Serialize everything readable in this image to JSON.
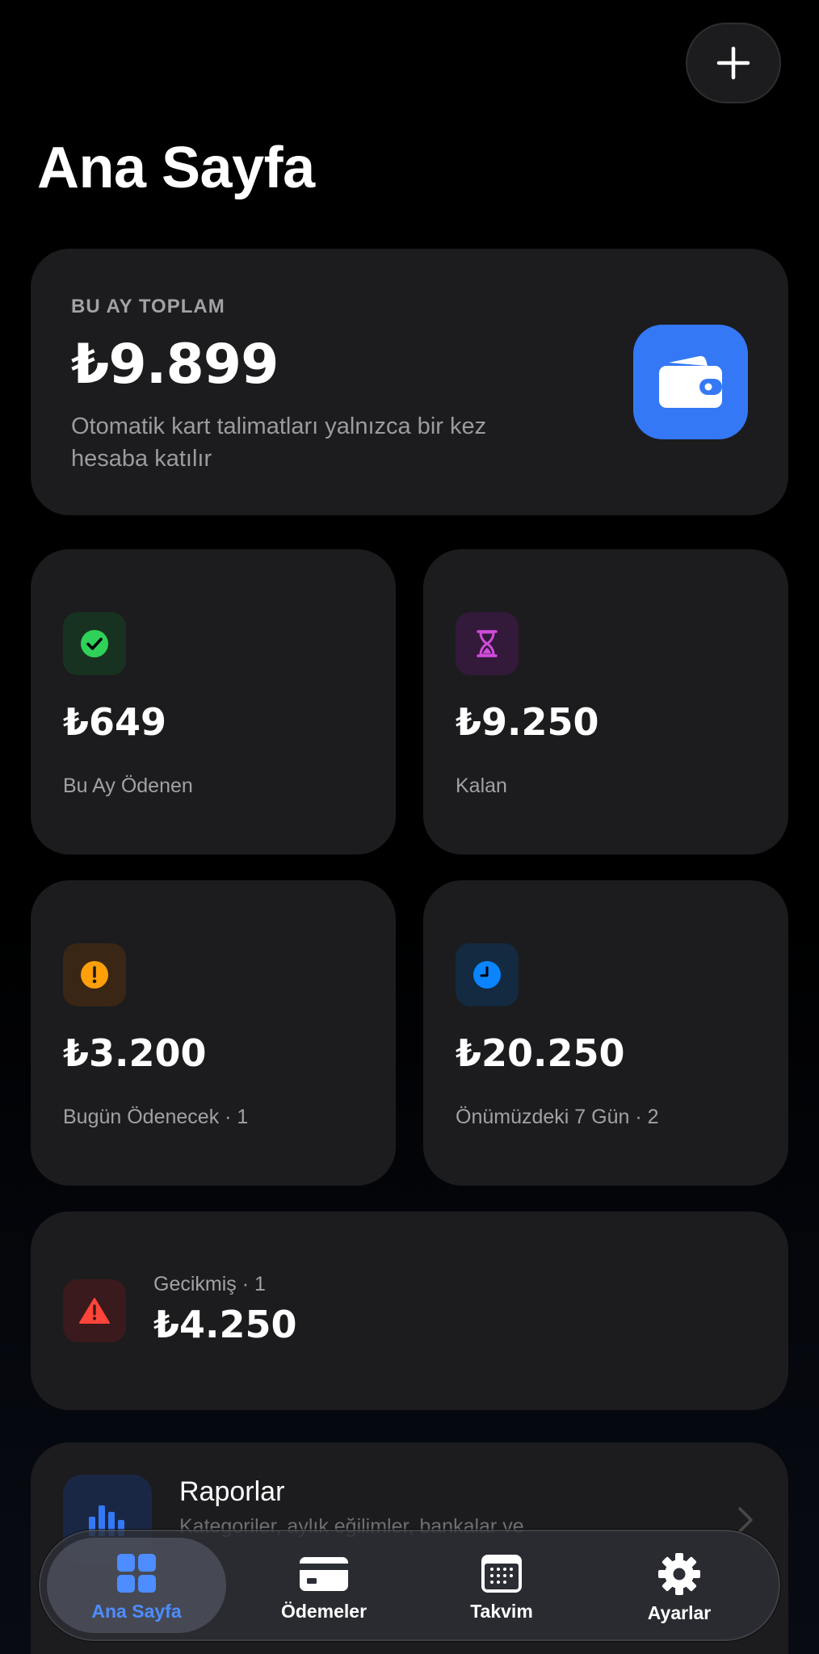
{
  "header": {
    "title": "Ana Sayfa",
    "add_icon": "plus-icon"
  },
  "summary": {
    "label": "BU AY TOPLAM",
    "amount": "₺9.899",
    "note": "Otomatik kart talimatları yalnızca bir kez hesaba katılır",
    "icon": "wallet-icon",
    "icon_color": "#3478f6"
  },
  "stats": [
    {
      "value": "₺649",
      "caption": "Bu Ay Ödenen",
      "icon": "checkmark-icon",
      "color": "#30d158"
    },
    {
      "value": "₺9.250",
      "caption": "Kalan",
      "icon": "hourglass-icon",
      "color": "#d14bdc"
    },
    {
      "value": "₺3.200",
      "caption": "Bugün Ödenecek · 1",
      "icon": "exclamation-icon",
      "color": "#ff9f0a"
    },
    {
      "value": "₺20.250",
      "caption": "Önümüzdeki 7 Gün · 2",
      "icon": "clock-icon",
      "color": "#0a84ff"
    }
  ],
  "overdue": {
    "caption": "Gecikmiş · 1",
    "value": "₺4.250",
    "icon": "warning-triangle-icon",
    "color": "#ff453a"
  },
  "reports": {
    "title": "Raporlar",
    "subtitle": "Kategoriler, aylık eğilimler, bankalar ve",
    "icon": "bar-chart-icon"
  },
  "tabbar": {
    "tabs": [
      {
        "label": "Ana Sayfa",
        "icon": "grid-icon",
        "active": true
      },
      {
        "label": "Ödemeler",
        "icon": "credit-card-icon",
        "active": false
      },
      {
        "label": "Takvim",
        "icon": "calendar-icon",
        "active": false
      },
      {
        "label": "Ayarlar",
        "icon": "gear-icon",
        "active": false
      }
    ],
    "accent": "#4d8dff"
  }
}
